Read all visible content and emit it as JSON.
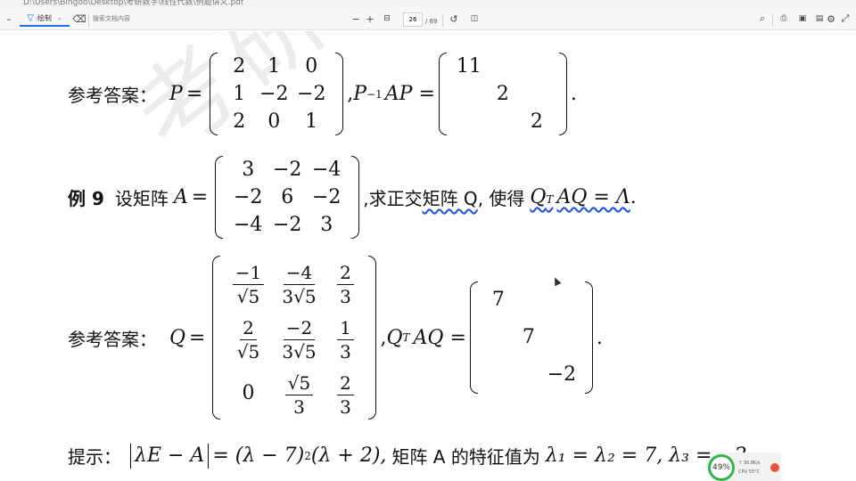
{
  "window": {
    "url": "D:\\Users\\Bingoo\\Desktop\\考研数学\\线性代数\\例题讲义.pdf"
  },
  "toolbar": {
    "draw_label": "绘制",
    "search_placeholder": "搜索文档内容",
    "page_current": "26",
    "page_total": "/ 69",
    "icons": [
      "draw-icon",
      "eraser-icon",
      "zoom-out-icon",
      "zoom-in-icon",
      "fit-icon",
      "rotate-icon",
      "two-page-icon",
      "search-icon",
      "print-icon",
      "save-icon",
      "save-as-icon",
      "settings-icon",
      "expand-icon"
    ],
    "zoom_out": "−",
    "zoom_in": "+"
  },
  "document": {
    "watermark": "考研数学",
    "answer1": {
      "label": "参考答案：",
      "P_lhs": "P",
      "P_matrix": [
        [
          "2",
          "1",
          "0"
        ],
        [
          "1",
          "−2",
          "−2"
        ],
        [
          "2",
          "0",
          "1"
        ]
      ],
      "rhs_prefix": ",",
      "P_inv": "P",
      "P_inv_sup": "−1",
      "AP": "AP =",
      "diag": [
        "11",
        "2",
        "2"
      ],
      "end": "."
    },
    "example9": {
      "label": "例 9",
      "text1": "设矩阵",
      "A": "A",
      "matrix": [
        [
          "3",
          "−2",
          "−4"
        ],
        [
          "−2",
          "6",
          "−2"
        ],
        [
          "−4",
          "−2",
          "3"
        ]
      ],
      "text2": ",求正交",
      "underlined": "矩阵 Q",
      "text3": ", 使得",
      "formula": "Q",
      "formula_sup": "T",
      "formula_rest": "AQ = Λ",
      "end": "."
    },
    "answer2": {
      "label": "参考答案：",
      "Q": "Q",
      "matrix": [
        [
          {
            "num": "−1",
            "den": "√5"
          },
          {
            "num": "−4",
            "den": "3√5"
          },
          {
            "num": "2",
            "den": "3"
          }
        ],
        [
          {
            "num": "2",
            "den": "√5"
          },
          {
            "num": "−2",
            "den": "3√5"
          },
          {
            "num": "1",
            "den": "3"
          }
        ],
        [
          {
            "plain": "0"
          },
          {
            "num": "√5",
            "den": "3"
          },
          {
            "num": "2",
            "den": "3"
          }
        ]
      ],
      "qtaq": "Q",
      "qtaq_sup": "T",
      "qtaq_rest": "AQ =",
      "diag": [
        "7",
        "7",
        "−2"
      ],
      "end": "."
    },
    "hint": {
      "label": "提示：",
      "abs": "λE − A",
      "expr1": "= (λ − 7)",
      "exp": "2",
      "expr2": "(λ + 2),",
      "text": "矩阵 A 的特征值为",
      "eig": "λ₁ = λ₂ = 7, λ₃ = −2."
    }
  },
  "widget": {
    "percent": "49%",
    "line1": "↑ 30.8K/s",
    "line2": "CPU 55°C"
  }
}
